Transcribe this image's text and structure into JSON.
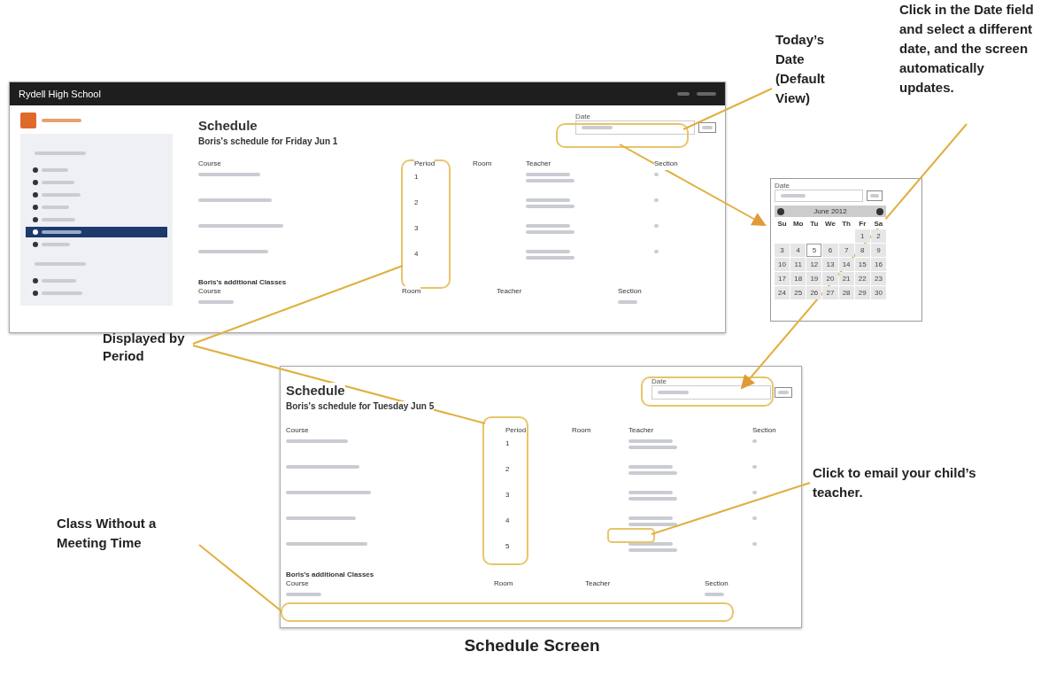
{
  "screens": [
    {
      "kind": "main",
      "app_title": "Rydell High School",
      "sidebar": {
        "items": [
          {
            "selected": false
          },
          {
            "selected": false
          },
          {
            "selected": false
          },
          {
            "selected": false
          },
          {
            "selected": false
          },
          {
            "selected": true
          },
          {
            "selected": false
          },
          {
            "selected": false
          },
          {
            "selected": false
          }
        ]
      },
      "heading": "Schedule",
      "subheading": "Boris's schedule for Friday Jun 1",
      "date_label": "Date",
      "columns": [
        "Course",
        "Period",
        "Room",
        "Teacher",
        "Section"
      ],
      "rows": [
        {
          "period": "1"
        },
        {
          "period": "2"
        },
        {
          "period": "3"
        },
        {
          "period": "4"
        }
      ],
      "additional": {
        "heading": "Boris's additional Classes",
        "columns": [
          "Course",
          "Room",
          "Teacher",
          "Section"
        ]
      }
    },
    {
      "kind": "detail",
      "heading": "Schedule",
      "subheading": "Boris's schedule for Tuesday Jun 5",
      "date_label": "Date",
      "columns": [
        "Course",
        "Period",
        "Room",
        "Teacher",
        "Section"
      ],
      "rows": [
        {
          "period": "1"
        },
        {
          "period": "2"
        },
        {
          "period": "3"
        },
        {
          "period": "4"
        },
        {
          "period": "5"
        }
      ],
      "additional": {
        "heading": "Boris's additional Classes",
        "columns": [
          "Course",
          "Room",
          "Teacher",
          "Section"
        ]
      }
    }
  ],
  "calendar": {
    "date_label": "Date",
    "month": "June 2012",
    "weekdays": [
      "Su",
      "Mo",
      "Tu",
      "We",
      "Th",
      "Fr",
      "Sa"
    ],
    "weeks": [
      [
        {
          "day": "1",
          "selected": false
        },
        {
          "day": "2",
          "selected": false
        }
      ],
      [
        {
          "day": "3",
          "selected": false
        },
        {
          "day": "4",
          "selected": false
        },
        {
          "day": "5",
          "selected": true
        },
        {
          "day": "6",
          "selected": false
        },
        {
          "day": "7",
          "selected": false
        },
        {
          "day": "8",
          "selected": false
        },
        {
          "day": "9",
          "selected": false
        }
      ],
      [
        {
          "day": "10",
          "selected": false
        },
        {
          "day": "11",
          "selected": false
        },
        {
          "day": "12",
          "selected": false
        },
        {
          "day": "13",
          "selected": false
        },
        {
          "day": "14",
          "selected": false
        },
        {
          "day": "15",
          "selected": false
        },
        {
          "day": "16",
          "selected": false
        }
      ],
      [
        {
          "day": "17",
          "selected": false
        },
        {
          "day": "18",
          "selected": false
        },
        {
          "day": "19",
          "selected": false
        },
        {
          "day": "20",
          "selected": false
        },
        {
          "day": "21",
          "selected": false
        },
        {
          "day": "22",
          "selected": false
        },
        {
          "day": "23",
          "selected": false
        }
      ],
      [
        {
          "day": "24",
          "selected": false
        },
        {
          "day": "25",
          "selected": false
        },
        {
          "day": "26",
          "selected": false
        },
        {
          "day": "27",
          "selected": false
        },
        {
          "day": "28",
          "selected": false
        },
        {
          "day": "29",
          "selected": false
        },
        {
          "day": "30",
          "selected": false
        }
      ]
    ]
  },
  "annotations": [
    "Today’s Date (Default View)",
    "Click in the Date field and select a different date, and the screen automatically updates.",
    "Displayed by Period",
    "Click to email your child’s teacher.",
    "Class Without a Meeting Time"
  ],
  "caption": "Schedule Screen"
}
